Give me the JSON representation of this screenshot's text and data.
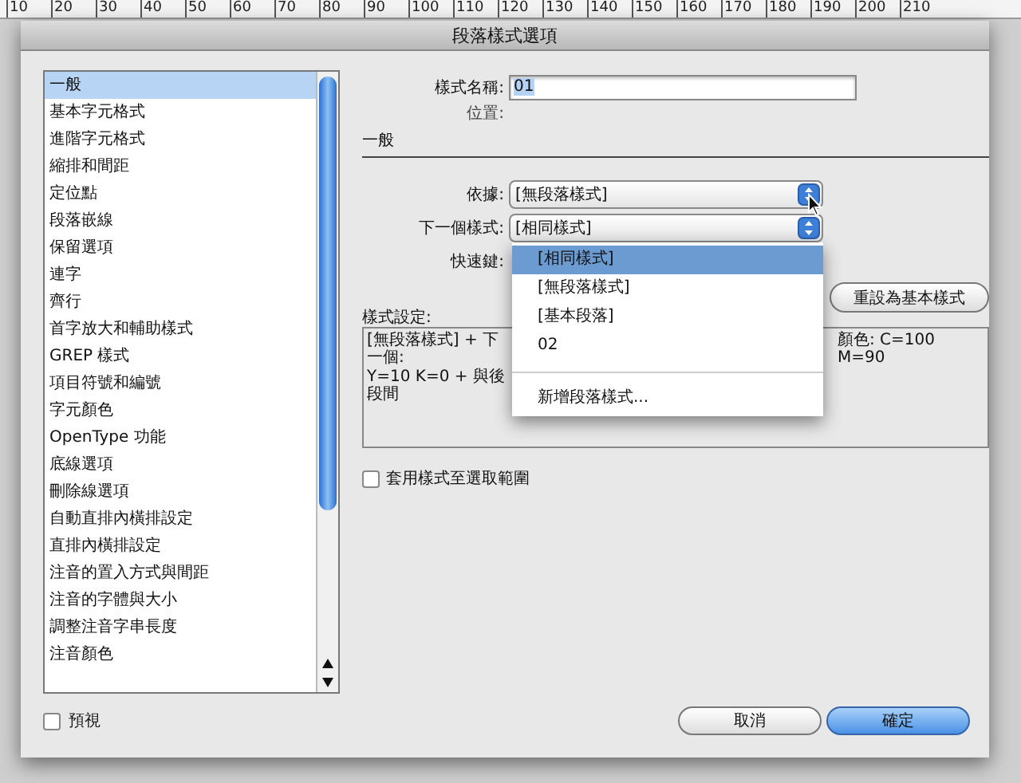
{
  "ruler": {
    "ticks": [
      "10",
      "20",
      "30",
      "40",
      "50",
      "60",
      "70",
      "80",
      "90",
      "100",
      "110",
      "120",
      "130",
      "140",
      "150",
      "160",
      "170",
      "180",
      "190",
      "200",
      "210"
    ]
  },
  "window": {
    "title": "段落樣式選項"
  },
  "sidebar": {
    "items": [
      {
        "label": "一般",
        "selected": true
      },
      {
        "label": "基本字元格式",
        "selected": false
      },
      {
        "label": "進階字元格式",
        "selected": false
      },
      {
        "label": "縮排和間距",
        "selected": false
      },
      {
        "label": "定位點",
        "selected": false
      },
      {
        "label": "段落嵌線",
        "selected": false
      },
      {
        "label": "保留選項",
        "selected": false
      },
      {
        "label": "連字",
        "selected": false
      },
      {
        "label": "齊行",
        "selected": false
      },
      {
        "label": "首字放大和輔助樣式",
        "selected": false
      },
      {
        "label": "GREP 樣式",
        "selected": false
      },
      {
        "label": "項目符號和編號",
        "selected": false
      },
      {
        "label": "字元顏色",
        "selected": false
      },
      {
        "label": "OpenType 功能",
        "selected": false
      },
      {
        "label": "底線選項",
        "selected": false
      },
      {
        "label": "刪除線選項",
        "selected": false
      },
      {
        "label": "自動直排內橫排設定",
        "selected": false
      },
      {
        "label": "直排內橫排設定",
        "selected": false
      },
      {
        "label": "注音的置入方式與間距",
        "selected": false
      },
      {
        "label": "注音的字體與大小",
        "selected": false
      },
      {
        "label": "調整注音字串長度",
        "selected": false
      },
      {
        "label": "注音顏色",
        "selected": false
      }
    ]
  },
  "general": {
    "style_name": {
      "label": "樣式名稱:",
      "value": "01"
    },
    "location": {
      "label": "位置:"
    },
    "section_title": "一般",
    "based_on": {
      "label": "依據:",
      "value": "[無段落樣式]"
    },
    "next_style": {
      "label": "下一個樣式:",
      "value": "[相同樣式]",
      "expanded": true,
      "options": [
        {
          "label": "[相同樣式]",
          "kind": "item",
          "selected": true
        },
        {
          "label": "[無段落樣式]",
          "kind": "item",
          "selected": false
        },
        {
          "label": "[基本段落]",
          "kind": "item",
          "selected": false
        },
        {
          "label": "02",
          "kind": "item",
          "selected": false
        },
        {
          "label": "新增段落樣式...",
          "kind": "command",
          "selected": false
        }
      ]
    },
    "shortcut": {
      "label": "快速鍵:"
    },
    "reset_button": "重設為基本樣式",
    "style_settings": {
      "label": "樣式設定:",
      "lines": [
        {
          "left": "[無段落樣式] + 下一個:",
          "right": "顏色: C=100 M=90"
        },
        {
          "left": "Y=10 K=0 + 與後段間"
        }
      ]
    },
    "apply_to_selection": {
      "label": "套用樣式至選取範圍",
      "checked": false
    }
  },
  "footer": {
    "preview": {
      "label": "預視",
      "checked": false
    },
    "buttons": [
      {
        "label": "取消",
        "default": false
      },
      {
        "label": "確定",
        "default": true
      }
    ]
  }
}
